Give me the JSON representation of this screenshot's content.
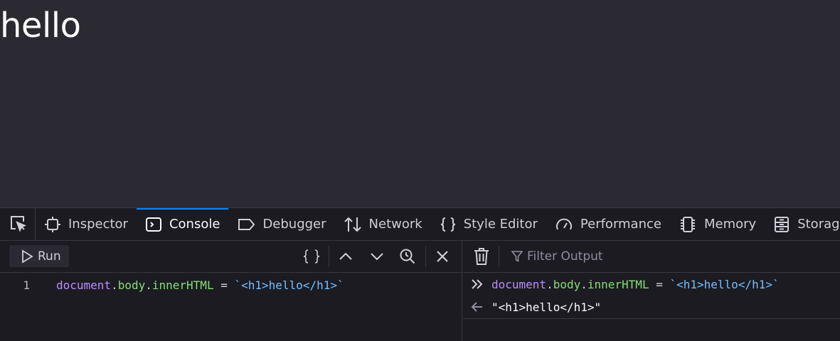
{
  "page": {
    "heading": "hello"
  },
  "devtools": {
    "tabs": [
      {
        "label": "Inspector"
      },
      {
        "label": "Console",
        "active": true
      },
      {
        "label": "Debugger"
      },
      {
        "label": "Network"
      },
      {
        "label": "Style Editor"
      },
      {
        "label": "Performance"
      },
      {
        "label": "Memory"
      },
      {
        "label": "Storage"
      }
    ],
    "editor": {
      "run_label": "Run",
      "line_number": "1",
      "code_tokens": {
        "object": "document",
        "dot1": ".",
        "prop1": "body",
        "dot2": ".",
        "prop2": "innerHTML",
        "assign": " = ",
        "string": "`<h1>hello</h1>`"
      }
    },
    "output": {
      "filter_placeholder": "Filter Output",
      "result_value": "\"<h1>hello</h1>\""
    },
    "colors": {
      "accent": "#0a84ff",
      "variable": "#b98eff",
      "property": "#86de74",
      "string": "#75bfff"
    }
  }
}
